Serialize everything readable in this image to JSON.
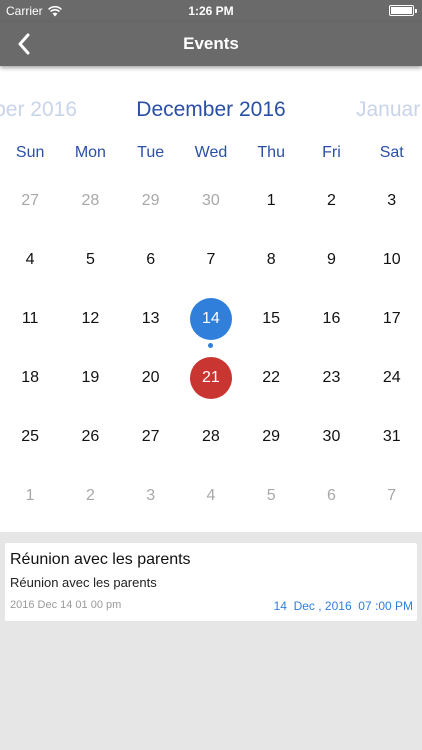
{
  "status_bar": {
    "carrier": "Carrier",
    "time": "1:26 PM",
    "battery_level": 1.0
  },
  "nav": {
    "title": "Events",
    "back_icon": "chevron-left-icon"
  },
  "calendar": {
    "prev_month": "ber 2016",
    "current_month": "December 2016",
    "next_month": "Januar",
    "weekdays": [
      "Sun",
      "Mon",
      "Tue",
      "Wed",
      "Thu",
      "Fri",
      "Sat"
    ],
    "weeks": [
      [
        {
          "d": "27",
          "other": true
        },
        {
          "d": "28",
          "other": true
        },
        {
          "d": "29",
          "other": true
        },
        {
          "d": "30",
          "other": true
        },
        {
          "d": "1"
        },
        {
          "d": "2"
        },
        {
          "d": "3"
        }
      ],
      [
        {
          "d": "4"
        },
        {
          "d": "5"
        },
        {
          "d": "6"
        },
        {
          "d": "7"
        },
        {
          "d": "8"
        },
        {
          "d": "9"
        },
        {
          "d": "10"
        }
      ],
      [
        {
          "d": "11"
        },
        {
          "d": "12"
        },
        {
          "d": "13"
        },
        {
          "d": "14",
          "today": true,
          "has_event": true
        },
        {
          "d": "15"
        },
        {
          "d": "16"
        },
        {
          "d": "17"
        }
      ],
      [
        {
          "d": "18"
        },
        {
          "d": "19"
        },
        {
          "d": "20"
        },
        {
          "d": "21",
          "marked": true
        },
        {
          "d": "22"
        },
        {
          "d": "23"
        },
        {
          "d": "24"
        }
      ],
      [
        {
          "d": "25"
        },
        {
          "d": "26"
        },
        {
          "d": "27"
        },
        {
          "d": "28"
        },
        {
          "d": "29"
        },
        {
          "d": "30"
        },
        {
          "d": "31"
        }
      ],
      [
        {
          "d": "1",
          "other": true
        },
        {
          "d": "2",
          "other": true
        },
        {
          "d": "3",
          "other": true
        },
        {
          "d": "4",
          "other": true
        },
        {
          "d": "5",
          "other": true
        },
        {
          "d": "6",
          "other": true
        },
        {
          "d": "7",
          "other": true
        }
      ]
    ]
  },
  "event": {
    "title": "Réunion avec les parents",
    "subtitle": "Réunion avec les parents",
    "date_raw": "2016 Dec 14 01 00 pm",
    "date_formatted": "14  Dec , 2016  07 :00 PM"
  },
  "colors": {
    "accent_blue": "#2f7fdb",
    "month_blue": "#2a4fa6",
    "marked_red": "#c93530",
    "navbar_gray": "#6a6a6a"
  }
}
